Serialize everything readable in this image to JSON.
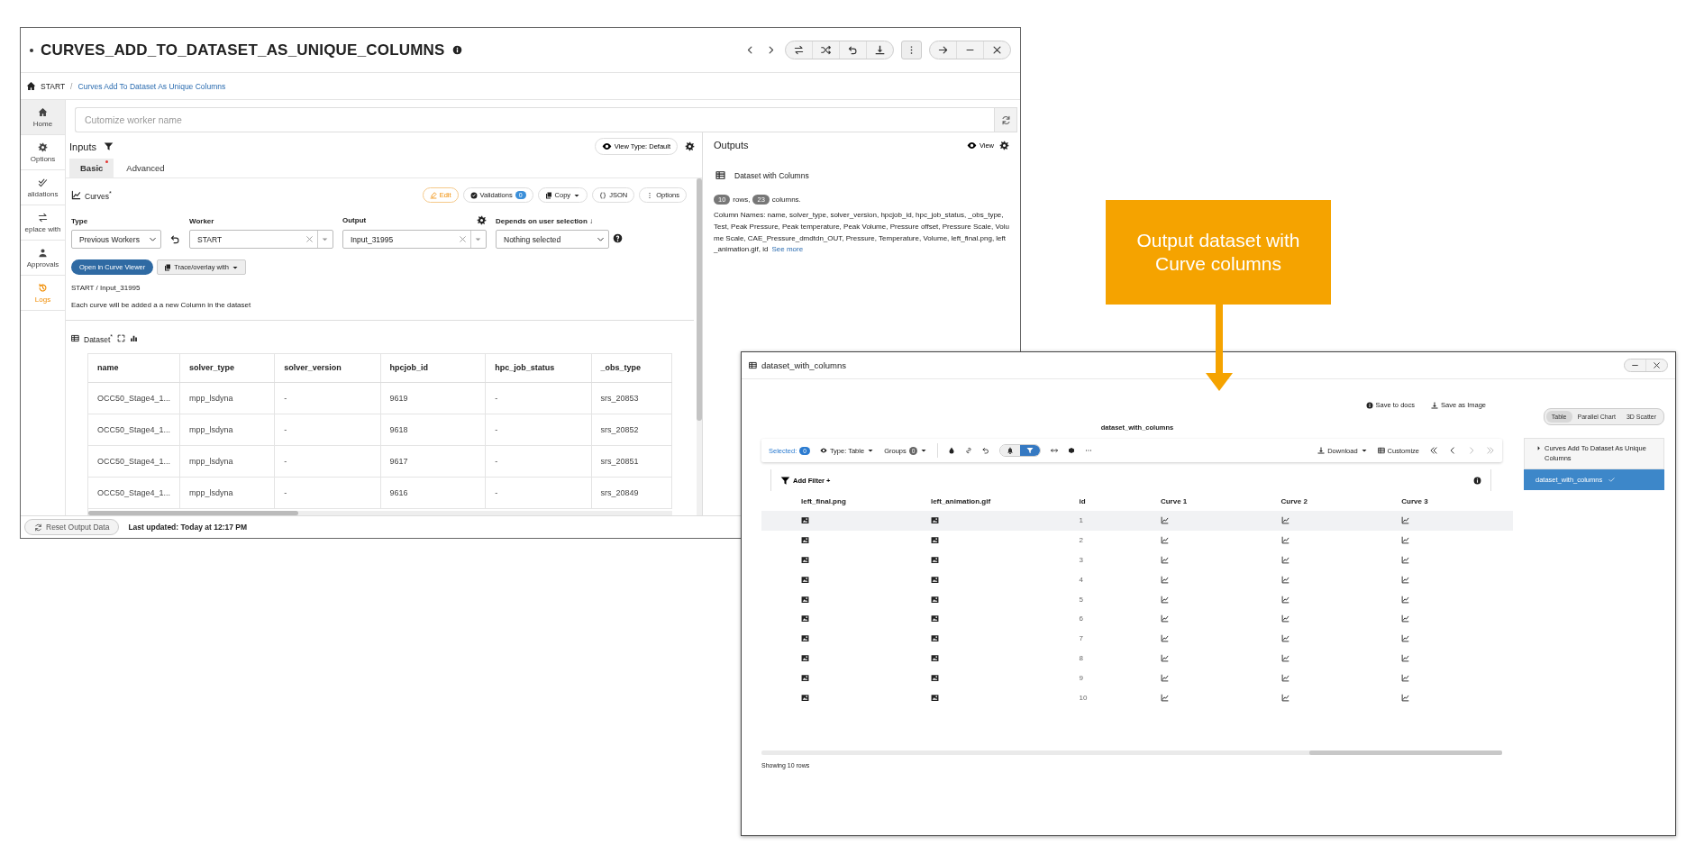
{
  "left_window": {
    "title": "CURVES_ADD_TO_DATASET_AS_UNIQUE_COLUMNS",
    "breadcrumb": {
      "items": [
        "START",
        "Curves Add To Dataset As Unique Columns"
      ],
      "separator": "/"
    },
    "sidebar": {
      "items": [
        {
          "label": "Home",
          "kind": "home",
          "selected": true,
          "highlighted": false
        },
        {
          "label": "Options",
          "kind": "options",
          "selected": false,
          "highlighted": false
        },
        {
          "label": "alidations",
          "kind": "validations",
          "selected": false,
          "highlighted": false
        },
        {
          "label": "eplace with",
          "kind": "replace",
          "selected": false,
          "highlighted": false
        },
        {
          "label": "Approvals",
          "kind": "approvals",
          "selected": false,
          "highlighted": false
        },
        {
          "label": "Logs",
          "kind": "logs",
          "selected": false,
          "highlighted": true
        }
      ]
    },
    "worker_name": {
      "placeholder": "Cutomize worker name"
    },
    "inputs": {
      "title": "Inputs",
      "view_type": "View Type: Default",
      "tabs": [
        {
          "label": "Basic",
          "selected": true,
          "required": true
        },
        {
          "label": "Advanced",
          "selected": false,
          "required": false
        }
      ],
      "curves": {
        "label": "Curves$^{*}$",
        "actions": [
          {
            "label": "Edit",
            "kind": "edit"
          },
          {
            "label": "Validations",
            "kind": "count",
            "count": "0"
          },
          {
            "label": "Copy",
            "kind": "dropdown"
          },
          {
            "label": "JSON",
            "kind": "json"
          },
          {
            "label": "Options",
            "kind": "options"
          }
        ],
        "fields": [
          {
            "label": "Type",
            "kind": "select",
            "value": "Previous Workers"
          },
          {
            "label": "Worker",
            "kind": "combo",
            "value": "START"
          },
          {
            "label": "Output",
            "kind": "combo",
            "value": "Input_31995"
          },
          {
            "label": "Depends on user selection ↓",
            "kind": "select",
            "value": "Nothing selected"
          }
        ],
        "buttons": [
          {
            "label": "Open in Curve Viewer",
            "kind": "primary"
          },
          {
            "label": "Trace/overlay with",
            "kind": "dropdown"
          }
        ],
        "path": "START / Input_31995",
        "note": "Each curve will be added a a new Column in the dataset"
      },
      "dataset": {
        "label": "Dataset$^{*}$",
        "columns": [
          "name",
          "solver_type",
          "solver_version",
          "hpcjob_id",
          "hpc_job_status",
          "_obs_type"
        ],
        "rows": [
          [
            "OCC50_Stage4_1...",
            "mpp_lsdyna",
            "-",
            "9619",
            "-",
            "srs_20853"
          ],
          [
            "OCC50_Stage4_1...",
            "mpp_lsdyna",
            "-",
            "9618",
            "-",
            "srs_20852"
          ],
          [
            "OCC50_Stage4_1...",
            "mpp_lsdyna",
            "-",
            "9617",
            "-",
            "srs_20851"
          ],
          [
            "OCC50_Stage4_1...",
            "mpp_lsdyna",
            "-",
            "9616",
            "-",
            "srs_20849"
          ]
        ]
      }
    },
    "outputs": {
      "title": "Outputs",
      "view": "View",
      "dataset": "Dataset with Columns",
      "rows_count": "10",
      "rows_label": "rows,",
      "columns_count": "23",
      "columns_label": "columns.",
      "column_names": "Column Names: name, solver_type, solver_version, hpcjob_id, hpc_job_status, _obs_type, Test, Peak Pressure, Peak temperature, Peak Volume, Pressure offset, Pressure Scale, Volume Scale, CAE_Pressure_dmdtdn_OUT, Pressure, Temperature, Volume, left_final.png, left_animation.gif, id",
      "see_more": "See more"
    },
    "footer": {
      "button": "Reset Output Data",
      "status": "Last updated: Today at 12:17 PM"
    }
  },
  "callout": {
    "text": "Output dataset with Curve columns"
  },
  "dataset_window": {
    "title": "dataset_with_columns",
    "links": [
      {
        "label": "Save to docs",
        "kind": "info"
      },
      {
        "label": "Save as Image",
        "kind": "download"
      }
    ],
    "heading": "dataset_with_columns",
    "toolbar": {
      "selected_label": "Selected:",
      "selected_count": "0",
      "type": "Type: Table",
      "groups_label": "Groups",
      "groups_count": "0",
      "download": "Download",
      "customize": "Customize",
      "toggles": [
        {
          "kind": "bell",
          "selected": false
        },
        {
          "kind": "filter",
          "selected": true
        }
      ],
      "pagination": [
        {
          "kind": "first",
          "disabled": false
        },
        {
          "kind": "previous",
          "disabled": false
        },
        {
          "kind": "next",
          "disabled": true
        },
        {
          "kind": "last",
          "disabled": true
        }
      ]
    },
    "filter": "Add Filter +",
    "columns": [
      {
        "label": "left_final.png",
        "kind": "image"
      },
      {
        "label": "left_animation.gif",
        "kind": "image"
      },
      {
        "label": "id",
        "kind": "id"
      },
      {
        "label": "Curve 1",
        "kind": "curve"
      },
      {
        "label": "Curve 2",
        "kind": "curve"
      },
      {
        "label": "Curve 3",
        "kind": "curve"
      }
    ],
    "rows": [
      {
        "id": "1",
        "highlighted": true
      },
      {
        "id": "2",
        "highlighted": false
      },
      {
        "id": "3",
        "highlighted": false
      },
      {
        "id": "4",
        "highlighted": false
      },
      {
        "id": "5",
        "highlighted": false
      },
      {
        "id": "6",
        "highlighted": false
      },
      {
        "id": "7",
        "highlighted": false
      },
      {
        "id": "8",
        "highlighted": false
      },
      {
        "id": "9",
        "highlighted": false
      },
      {
        "id": "10",
        "highlighted": false
      }
    ],
    "footer": "Showing 10 rows",
    "view_tabs": [
      {
        "label": "Table",
        "selected": true
      },
      {
        "label": "Parallel Chart",
        "selected": false
      },
      {
        "label": "3D Scatter",
        "selected": false
      }
    ],
    "tree": [
      {
        "label": "Curves Add To Dataset As Unique Columns",
        "kind": "group",
        "selected": false
      },
      {
        "label": "dataset_with_columns",
        "kind": "item",
        "selected": true
      }
    ]
  }
}
